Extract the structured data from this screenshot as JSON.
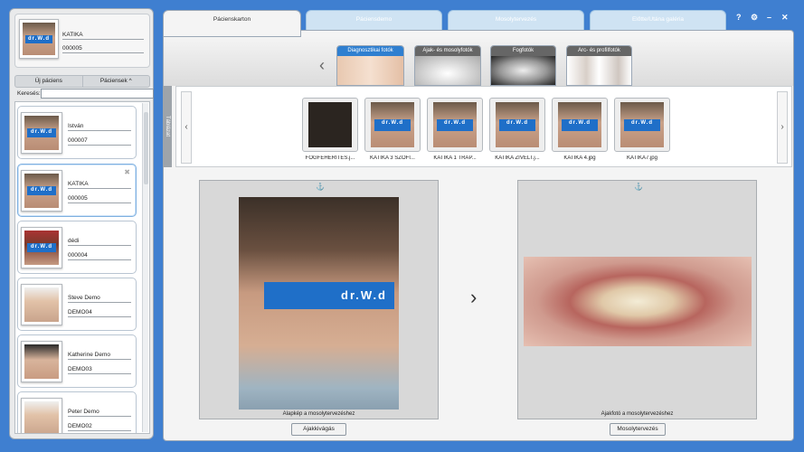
{
  "current_patient": {
    "name": "KATIKA",
    "id": "000005"
  },
  "sidebar": {
    "new_patient_label": "Új páciens",
    "patients_label": "Páciensek ^",
    "search_label": "Keresés:",
    "search_value": "",
    "patients": [
      {
        "name": "István",
        "id": "000007"
      },
      {
        "name": "KATIKA",
        "id": "000005",
        "selected": true
      },
      {
        "name": "dédi",
        "id": "000004"
      },
      {
        "name": "Steve Demo",
        "id": "DEMO04"
      },
      {
        "name": "Katherine Demo",
        "id": "DEMO03"
      },
      {
        "name": "Peter Demo",
        "id": "DEMO02"
      }
    ]
  },
  "tabs": [
    "Pácienskarton",
    "Páciensdemo",
    "Mosolytervezés",
    "Előtte/Utána galéria"
  ],
  "active_tab": "Pácienskarton",
  "window_controls": [
    "?",
    "⚙",
    "–",
    "✕"
  ],
  "categories": [
    "Diagnosztikai fotók",
    "Ajak- és mosolyfotók",
    "Fogfotók",
    "Arc- és profilfotók"
  ],
  "active_category": "Diagnosztikai fotók",
  "table_tab_label": "Táblázat",
  "thumbnails": [
    {
      "caption": "FOGFEHÉRÍTÉS.j..."
    },
    {
      "caption": "KATIKA 3 SZOFI..."
    },
    {
      "caption": "KATIKA 1 TRAP..."
    },
    {
      "caption": "KATIKA ZÍVELT.j..."
    },
    {
      "caption": "KATIKA 4.jpg"
    },
    {
      "caption": "KATIKA7.jpg"
    }
  ],
  "logo_text": "dr.W.d",
  "left_view": {
    "caption": "Alapkép a mosolytervezéshez",
    "button": "Ajakkivágás"
  },
  "right_view": {
    "caption": "Ajakfotó a mosolytervezéshez",
    "button": "Mosolytervezés"
  },
  "colors": {
    "background": "#3f7fd0",
    "accent": "#2f7fd0",
    "logo_bar": "#1f6fc8"
  }
}
